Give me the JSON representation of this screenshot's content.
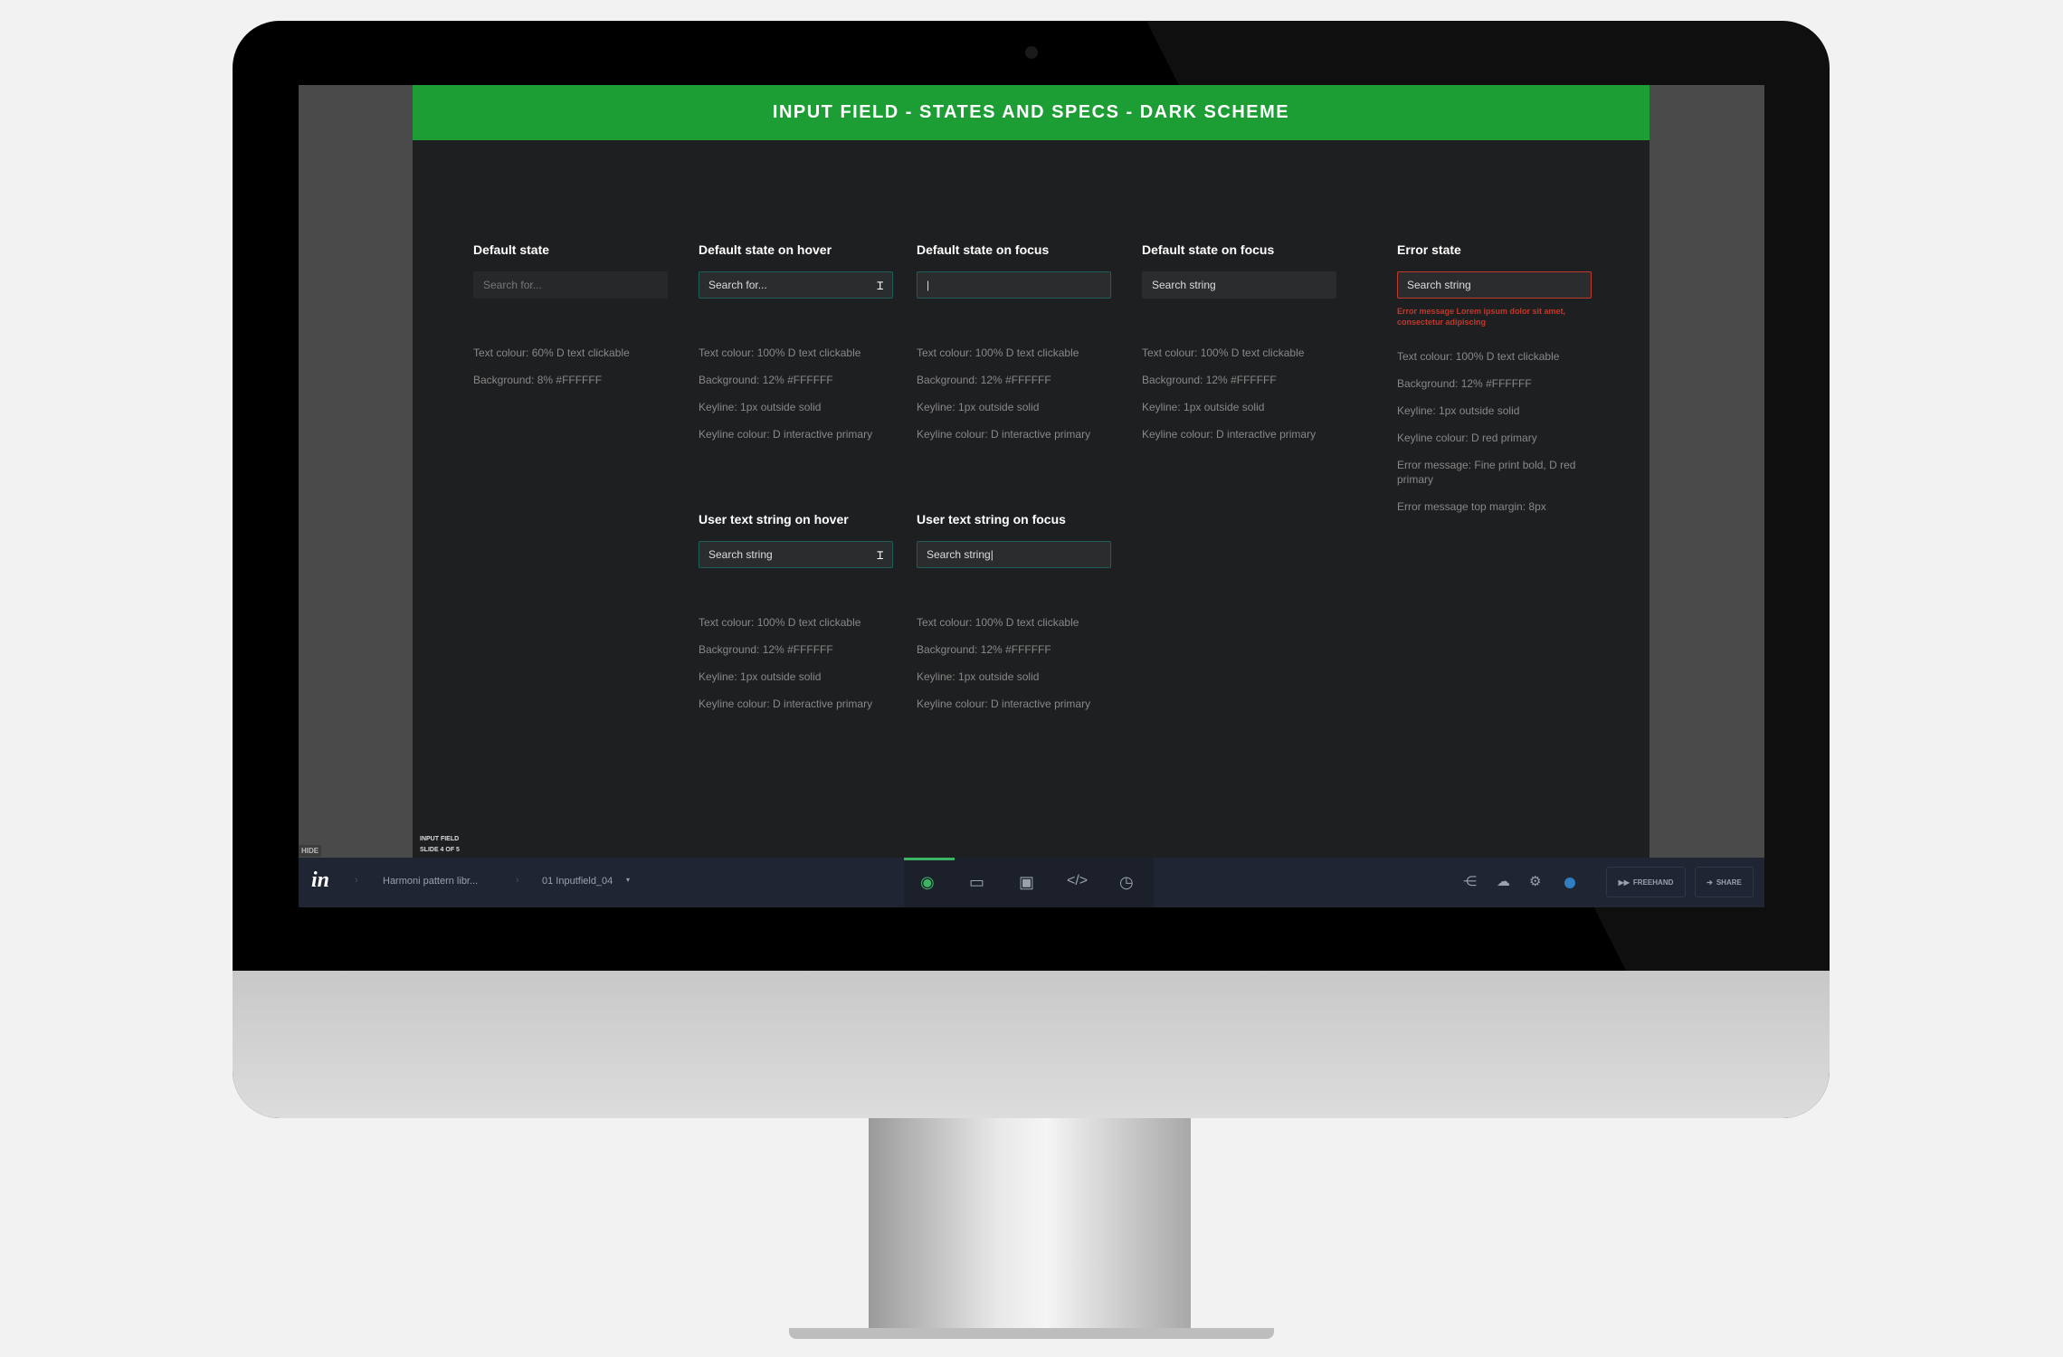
{
  "slide": {
    "title": "INPUT FIELD - STATES AND SPECS - DARK SCHEME",
    "caption_line1": "INPUT FIELD",
    "caption_line2": "SLIDE 4 OF 5",
    "hide_label": "HIDE"
  },
  "columns": [
    {
      "title": "Default state",
      "input": "Search for...",
      "specs": [
        "Text colour: 60% D text clickable",
        "Background: 8% #FFFFFF"
      ]
    },
    {
      "title": "Default state on hover",
      "input": "Search for...",
      "specs": [
        "Text colour: 100% D text clickable",
        "Background: 12% #FFFFFF",
        "Keyline: 1px outside solid",
        "Keyline colour: D interactive primary"
      ]
    },
    {
      "title": "Default state on focus",
      "input": "|",
      "specs": [
        "Text colour: 100% D text clickable",
        "Background: 12% #FFFFFF",
        "Keyline: 1px outside solid",
        "Keyline colour: D interactive primary"
      ]
    },
    {
      "title": "Default state on focus",
      "input": "Search string",
      "specs": [
        "Text colour: 100% D text clickable",
        "Background: 12% #FFFFFF",
        "Keyline: 1px outside solid",
        "Keyline colour: D interactive primary"
      ]
    },
    {
      "title": "Error state",
      "input": "Search string",
      "error": "Error message Lorem ipsum dolor sit amet, consectetur adipiscing",
      "specs": [
        "Text colour: 100% D text clickable",
        "Background: 12% #FFFFFF",
        "Keyline: 1px outside solid",
        "Keyline colour: D red primary",
        "Error message: Fine print bold, D red primary",
        "Error message top margin: 8px"
      ]
    }
  ],
  "row2": [
    {
      "title": "User text string on hover",
      "input": "Search string",
      "specs": [
        "Text colour: 100% D text clickable",
        "Background: 12% #FFFFFF",
        "Keyline: 1px outside solid",
        "Keyline colour: D interactive primary"
      ]
    },
    {
      "title": "User text string on focus",
      "input": "Search string|",
      "specs": [
        "Text colour: 100% D text clickable",
        "Background: 12% #FFFFFF",
        "Keyline: 1px outside solid",
        "Keyline colour: D interactive primary"
      ]
    }
  ],
  "toolbar": {
    "logo": "in",
    "breadcrumb1": "Harmoni pattern libr...",
    "breadcrumb2": "01 Inputfield_04",
    "freehand": "FREEHAND",
    "share": "SHARE"
  },
  "colors": {
    "header": "#1c9e35",
    "error": "#c0392b",
    "focus": "#1f5c5a",
    "active_tab": "#3cb563",
    "toolbar": "#1f2533"
  }
}
